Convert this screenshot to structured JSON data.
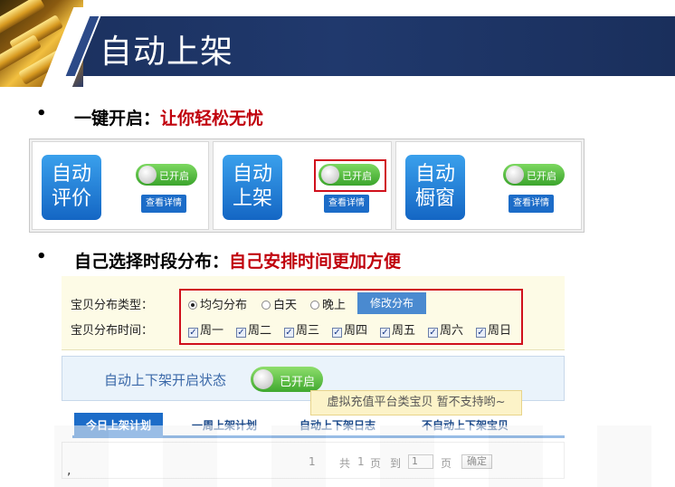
{
  "header": {
    "title": "自动上架"
  },
  "bullets": [
    {
      "lead": "一键开启：",
      "emphasis": "让你轻松无忧"
    },
    {
      "lead": "自己选择时段分布：",
      "emphasis": "自己安排时间更加方便"
    }
  ],
  "cards": [
    {
      "tile": "自动评价",
      "toggle": "已开启",
      "detail": "查看详情"
    },
    {
      "tile": "自动上架",
      "toggle": "已开启",
      "detail": "查看详情"
    },
    {
      "tile": "自动橱窗",
      "toggle": "已开启",
      "detail": "查看详情"
    }
  ],
  "panel": {
    "dist_type_label": "宝贝分布类型：",
    "dist_types": [
      "均匀分布",
      "白天",
      "晚上"
    ],
    "selected_type": "均匀分布",
    "modify_button": "修改分布",
    "dist_time_label": "宝贝分布时间：",
    "days": [
      "周一",
      "周二",
      "周三",
      "周四",
      "周五",
      "周六",
      "周日"
    ],
    "status_label": "自动上下架开启状态",
    "status_toggle": "已开启",
    "tooltip": "虚拟充值平台类宝贝 暂不支持哟~",
    "tabs": [
      "今日上架计划",
      "一周上架计划",
      "自动上下架日志",
      "不自动上下架宝贝"
    ],
    "active_tab": "今日上架计划",
    "pager": {
      "current": "1",
      "total_prefix": "共",
      "total": "1",
      "page": "页",
      "goto": "到",
      "input": "1",
      "unit": "页",
      "ok": "确定"
    }
  },
  "footer_mark": ","
}
